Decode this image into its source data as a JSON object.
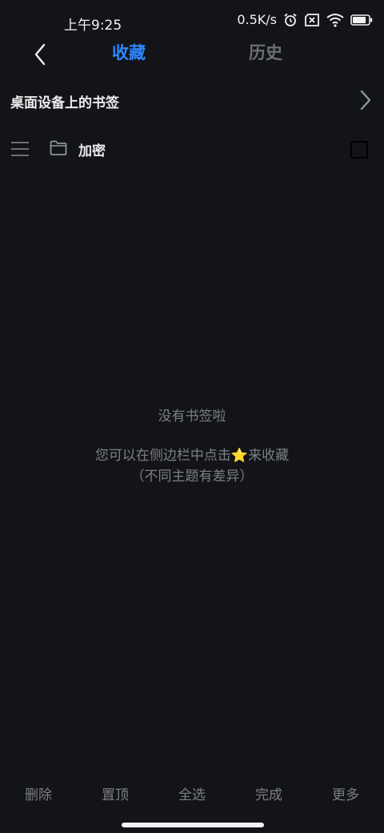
{
  "status_bar": {
    "time": "上午9:25",
    "net_speed": "0.5K/s",
    "battery_level": 0.85,
    "icons": [
      "alarm-icon",
      "sim-x-icon",
      "wifi-icon",
      "battery-icon"
    ]
  },
  "nav": {
    "back_icon": "chevron-left-icon",
    "tabs": [
      {
        "label": "收藏",
        "active": true
      },
      {
        "label": "历史",
        "active": false
      }
    ]
  },
  "desktop_bookmarks": {
    "label": "桌面设备上的书签",
    "icon": "chevron-right-icon"
  },
  "folder": {
    "label": "加密",
    "icons": [
      "drag-handle-icon",
      "folder-icon"
    ],
    "checked": false
  },
  "empty_state": {
    "title": "没有书签啦",
    "hint_before": "您可以在侧边栏中点击",
    "hint_star": "⭐",
    "hint_after": "来收藏",
    "note": "（不同主题有差异）"
  },
  "bottom_bar": {
    "buttons": [
      "删除",
      "置顶",
      "全选",
      "完成",
      "更多"
    ]
  },
  "colors": {
    "background": "#131417",
    "accent": "#2f86ff",
    "muted": "#7c7f86",
    "tab_inactive": "#6b6e74"
  }
}
